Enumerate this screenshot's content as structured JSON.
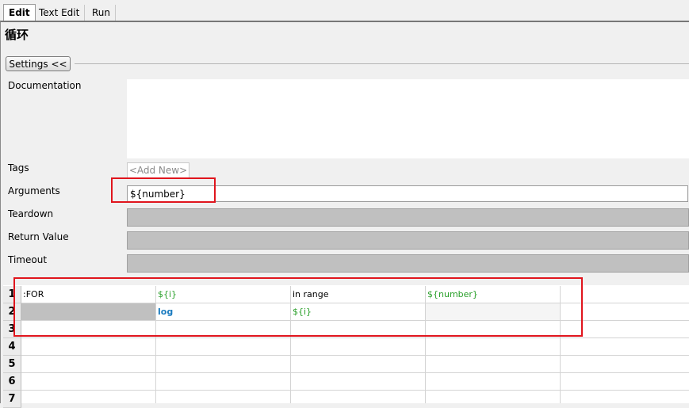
{
  "tabs": [
    {
      "label": "Edit"
    },
    {
      "label": "Text Edit"
    },
    {
      "label": "Run"
    }
  ],
  "page_title": "循环",
  "settings_button": "Settings <<",
  "fields": {
    "documentation_label": "Documentation",
    "documentation_value": "",
    "tags_label": "Tags",
    "tags_add_new": "<Add New>",
    "arguments_label": "Arguments",
    "arguments_value": "${number}",
    "teardown_label": "Teardown",
    "return_value_label": "Return Value",
    "timeout_label": "Timeout"
  },
  "grid": {
    "row_numbers": [
      "1",
      "2",
      "3",
      "4",
      "5",
      "6",
      "7"
    ],
    "rows": [
      [
        "FOR",
        "${i}",
        "in range",
        "${number}"
      ],
      [
        "",
        "log",
        "${i}",
        ""
      ]
    ]
  },
  "colors": {
    "highlight_box": "#e0151d",
    "variable_text": "#2aa02a",
    "keyword_text": "#1a7bbf"
  }
}
